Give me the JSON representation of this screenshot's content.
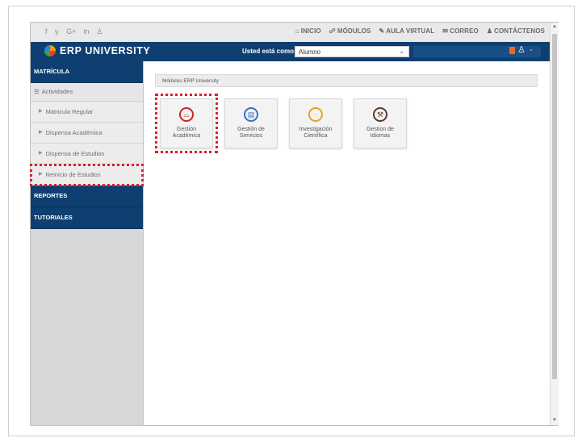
{
  "topbar": {
    "social": [
      "f",
      "𝕪",
      "G+",
      "in",
      "♙"
    ],
    "nav": [
      {
        "icon": "home-icon",
        "glyph": "⌂",
        "label": "INICIO"
      },
      {
        "icon": "modules-icon",
        "glyph": "☍",
        "label": "MÓDULOS"
      },
      {
        "icon": "graduation-icon",
        "glyph": "✎",
        "label": "AULA VIRTUAL"
      },
      {
        "icon": "mail-icon",
        "glyph": "✉",
        "label": "CORREO"
      },
      {
        "icon": "user-icon",
        "glyph": "♟",
        "label": "CONTÁCTENOS"
      }
    ]
  },
  "header": {
    "brand": "ERP UNIVERSITY",
    "role_label": "Usted está como:",
    "role_value": "Alumno",
    "notif_badge": "",
    "user_glyph": "♙"
  },
  "sidebar": {
    "section_matricula": "MATRÍCULA",
    "sub_actividades": "Actividades",
    "items": [
      "Matricula Regular",
      "Dispensa Académica",
      "Dispensa de Estudios",
      "Reinicio de Estudios"
    ],
    "section_reportes": "REPORTES",
    "section_tutoriales": "TUTORIALES"
  },
  "content": {
    "breadcrumb": "Módulos ERP University",
    "tiles": [
      {
        "label": "Gestión\nAcadémica",
        "icon": "graduation-cap-icon",
        "glyph": "⌓",
        "color": "#c9242b"
      },
      {
        "label": "Gestión de\nServicios",
        "icon": "document-icon",
        "glyph": "▤",
        "color": "#3a6fc4"
      },
      {
        "label": "Investigación\nCientífica",
        "icon": "chat-icon",
        "glyph": "◌",
        "color": "#e8a21c"
      },
      {
        "label": "Gestion de\nIdiomas",
        "icon": "gavel-icon",
        "glyph": "⚒",
        "color": "#5a3a2a"
      }
    ]
  },
  "colors": {
    "primary": "#0f3f70",
    "highlight": "#d9202a"
  }
}
